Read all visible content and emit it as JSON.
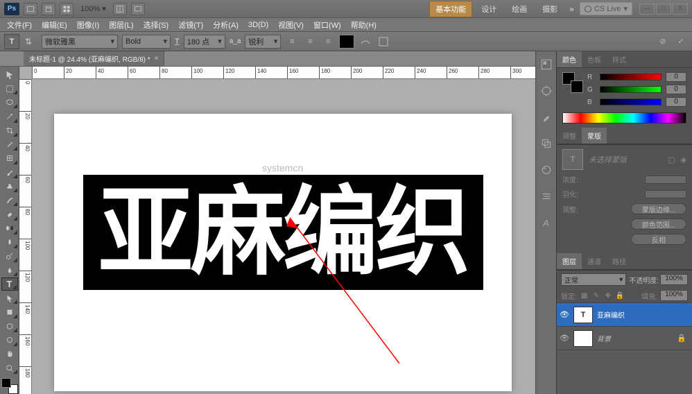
{
  "titlebar": {
    "logo": "Ps",
    "zoom": "100% ▾",
    "workspaces": [
      "基本功能",
      "设计",
      "绘画",
      "摄影"
    ],
    "cslive": "CS Live",
    "win": {
      "min": "—",
      "max": "□",
      "close": "✕"
    }
  },
  "menu": [
    "文件(F)",
    "编辑(E)",
    "图像(I)",
    "图层(L)",
    "选择(S)",
    "滤镜(T)",
    "分析(A)",
    "3D(D)",
    "视图(V)",
    "窗口(W)",
    "帮助(H)"
  ],
  "options": {
    "tool_letter": "T",
    "font_family": "微软雅黑",
    "font_style": "Bold",
    "size_value": "180 点",
    "aa_label": "a_a",
    "aa_value": "锐利"
  },
  "doctab": {
    "title": "未标题-1 @ 24.4% (亚麻编织, RGB/8) *",
    "close": "×"
  },
  "canvas": {
    "text": "亚麻编织",
    "watermark": "systemcn"
  },
  "ruler_h": [
    0,
    20,
    40,
    60,
    80,
    100,
    120,
    140,
    160,
    180,
    200,
    220,
    240,
    260,
    280,
    300
  ],
  "ruler_v": [
    0,
    20,
    40,
    60,
    80,
    100,
    120,
    140,
    160,
    180
  ],
  "color_panel": {
    "tabs": [
      "颜色",
      "色板",
      "样式"
    ],
    "channels": [
      {
        "l": "R",
        "v": "0"
      },
      {
        "l": "G",
        "v": "0"
      },
      {
        "l": "B",
        "v": "0"
      }
    ]
  },
  "mask_panel": {
    "tabs": [
      "调整",
      "蒙版"
    ],
    "placeholder": "未选择蒙版",
    "rows": [
      {
        "l": "浓度:"
      },
      {
        "l": "羽化:"
      }
    ],
    "adjust_label": "调整:",
    "btns": [
      "蒙版边缘...",
      "颜色范围...",
      "反相"
    ]
  },
  "layers_panel": {
    "tabs": [
      "图层",
      "通道",
      "路径"
    ],
    "blend": "正常",
    "opacity_label": "不透明度:",
    "opacity": "100%",
    "lock_label": "锁定:",
    "fill_label": "填充:",
    "fill": "100%",
    "layers": [
      {
        "name": "亚麻编织",
        "thumb": "T",
        "selected": true,
        "locked": false
      },
      {
        "name": "背景",
        "thumb": "",
        "selected": false,
        "locked": true
      }
    ]
  }
}
